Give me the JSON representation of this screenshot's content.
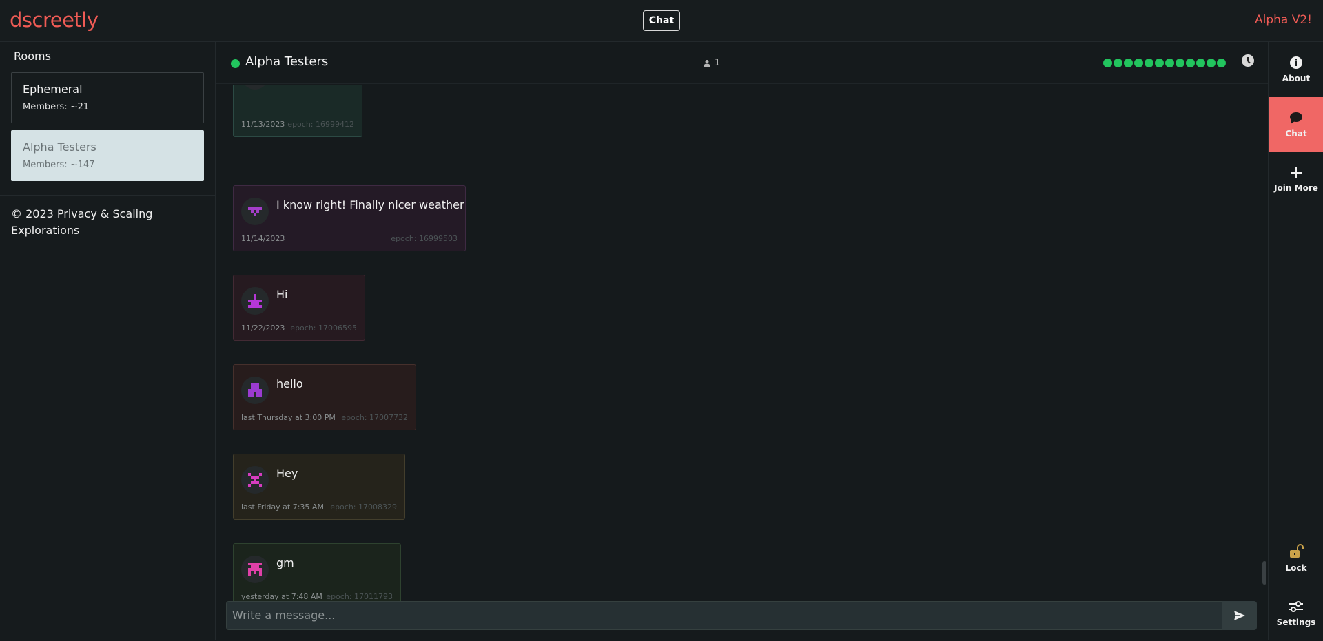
{
  "header": {
    "logo": "dscreetly",
    "center_button": "Chat",
    "version": "Alpha V2!"
  },
  "sidebar": {
    "title": "Rooms",
    "rooms": [
      {
        "name": "Ephemeral",
        "members": "Members: ~21"
      },
      {
        "name": "Alpha Testers",
        "members": "Members: ~147"
      }
    ],
    "copyright": "© 2023 Privacy & Scaling Explorations"
  },
  "room": {
    "title": "Alpha Testers",
    "users": "1",
    "status_color": "#22c55e"
  },
  "messages": [
    {
      "text": "",
      "time": "11/13/2023",
      "epoch": "epoch: 16999412",
      "bg": "#1a2a27",
      "border": "#2c4a44"
    },
    {
      "text": "I know right! Finally nicer weather",
      "time": "11/14/2023",
      "epoch": "epoch: 16999503",
      "bg": "#241a26",
      "border": "#3f2a43"
    },
    {
      "text": "Hi",
      "time": "11/22/2023",
      "epoch": "epoch: 17006595",
      "bg": "#261a20",
      "border": "#432a34"
    },
    {
      "text": "hello",
      "time": "last Thursday at 3:00 PM",
      "epoch": "epoch: 17007732",
      "bg": "#271c1c",
      "border": "#46302c"
    },
    {
      "text": "Hey",
      "time": "last Friday at 7:35 AM",
      "epoch": "epoch: 17008329",
      "bg": "#25231b",
      "border": "#433e2c"
    },
    {
      "text": "gm",
      "time": "yesterday at 7:48 AM",
      "epoch": "epoch: 17011793",
      "bg": "#1b241c",
      "border": "#2e422f"
    }
  ],
  "composer": {
    "placeholder": "Write a message..."
  },
  "nav": {
    "about": "About",
    "chat": "Chat",
    "join_more": "Join More",
    "lock": "Lock",
    "settings": "Settings"
  },
  "colors": {
    "brand": "#ef5b55",
    "active_nav": "#f06765",
    "online": "#22c55e"
  }
}
